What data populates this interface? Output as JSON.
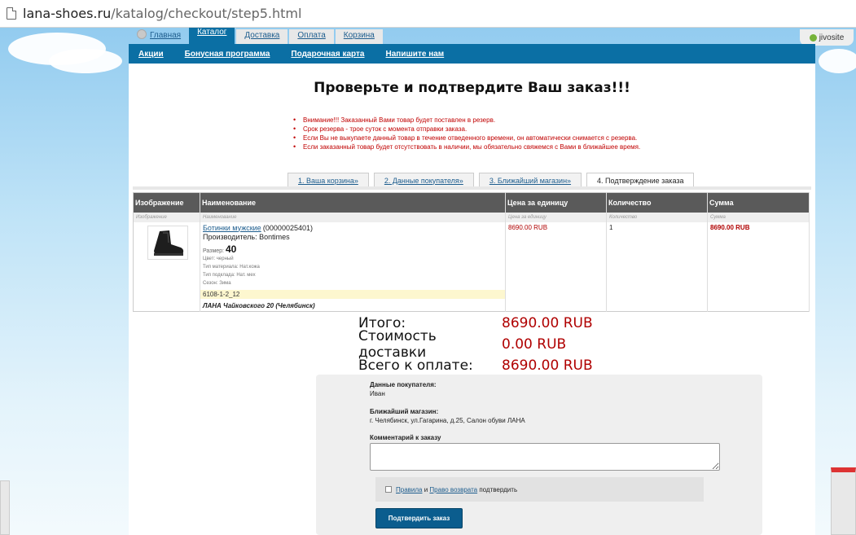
{
  "browser": {
    "url_domain": "lana-shoes.ru",
    "url_path": "/katalog/checkout/step5.html"
  },
  "top_nav": {
    "tabs": [
      "Главная",
      "Каталог",
      "Доставка",
      "Оплата",
      "Корзина"
    ]
  },
  "widget": {
    "label": "jivosite"
  },
  "blue_nav": {
    "links": [
      "Акции",
      "Бонусная программа",
      "Подарочная карта",
      "Напишите нам"
    ]
  },
  "page_title": "Проверьте и подтвердите Ваш заказ!!!",
  "notices": [
    "Внимание!!! Заказанный Вами товар будет поставлен в резерв.",
    "Срок резерва - трое суток с момента отправки заказа.",
    "Если Вы не выкупаете данный товар в течение отведенного времени, он автоматически снимается с резерва.",
    "Если заказанный товар будет отсутствовать в наличии, мы обязательно свяжемся с Вами в ближайшее время."
  ],
  "steps": [
    "1. Ваша корзина»",
    "2. Данные покупателя»",
    "3. Ближайший магазин»",
    "4. Подтверждение заказа"
  ],
  "table": {
    "headers": [
      "Изображение",
      "Наименование",
      "Цена за единицу",
      "Количество",
      "Сумма"
    ],
    "sub_headers": [
      "Изображение",
      "Наименование",
      "Цена за единицу",
      "Количество",
      "Сумма"
    ],
    "item": {
      "name": "Ботинки мужские",
      "code": "(00000025401)",
      "maker": "Производитель: Bontimes",
      "size_label": "Размер:",
      "size": "40",
      "attrs": [
        "Цвет: черный",
        "Тип материала: Нат.кожа",
        "Тип подклада: Нат. мех",
        "Сезон: Зима"
      ],
      "article": "6108-1-2_12",
      "store": "ЛАНА Чайковского 20 (Челябинск)",
      "price": "8690.00 RUB",
      "qty": "1",
      "sum": "8690.00 RUB"
    }
  },
  "totals": [
    {
      "label": "Итого:",
      "value": "8690.00 RUB"
    },
    {
      "label": "Стоимость доставки",
      "value": "0.00 RUB"
    },
    {
      "label": "Всего к оплате:",
      "value": "8690.00 RUB"
    }
  ],
  "customer": {
    "buyer_label": "Данные покупателя:",
    "buyer_value": "Иван",
    "store_label": "Ближайший магазин:",
    "store_value": "г. Челябинск, ул.Гагарина, д.25, Салон обуви ЛАНА",
    "comment_label": "Комментарий к заказу",
    "rules_link": "Правила",
    "and_text": "и",
    "return_link": "Право возврата",
    "confirm_text": "подтвердить",
    "submit_label": "Подтвердить заказ"
  }
}
